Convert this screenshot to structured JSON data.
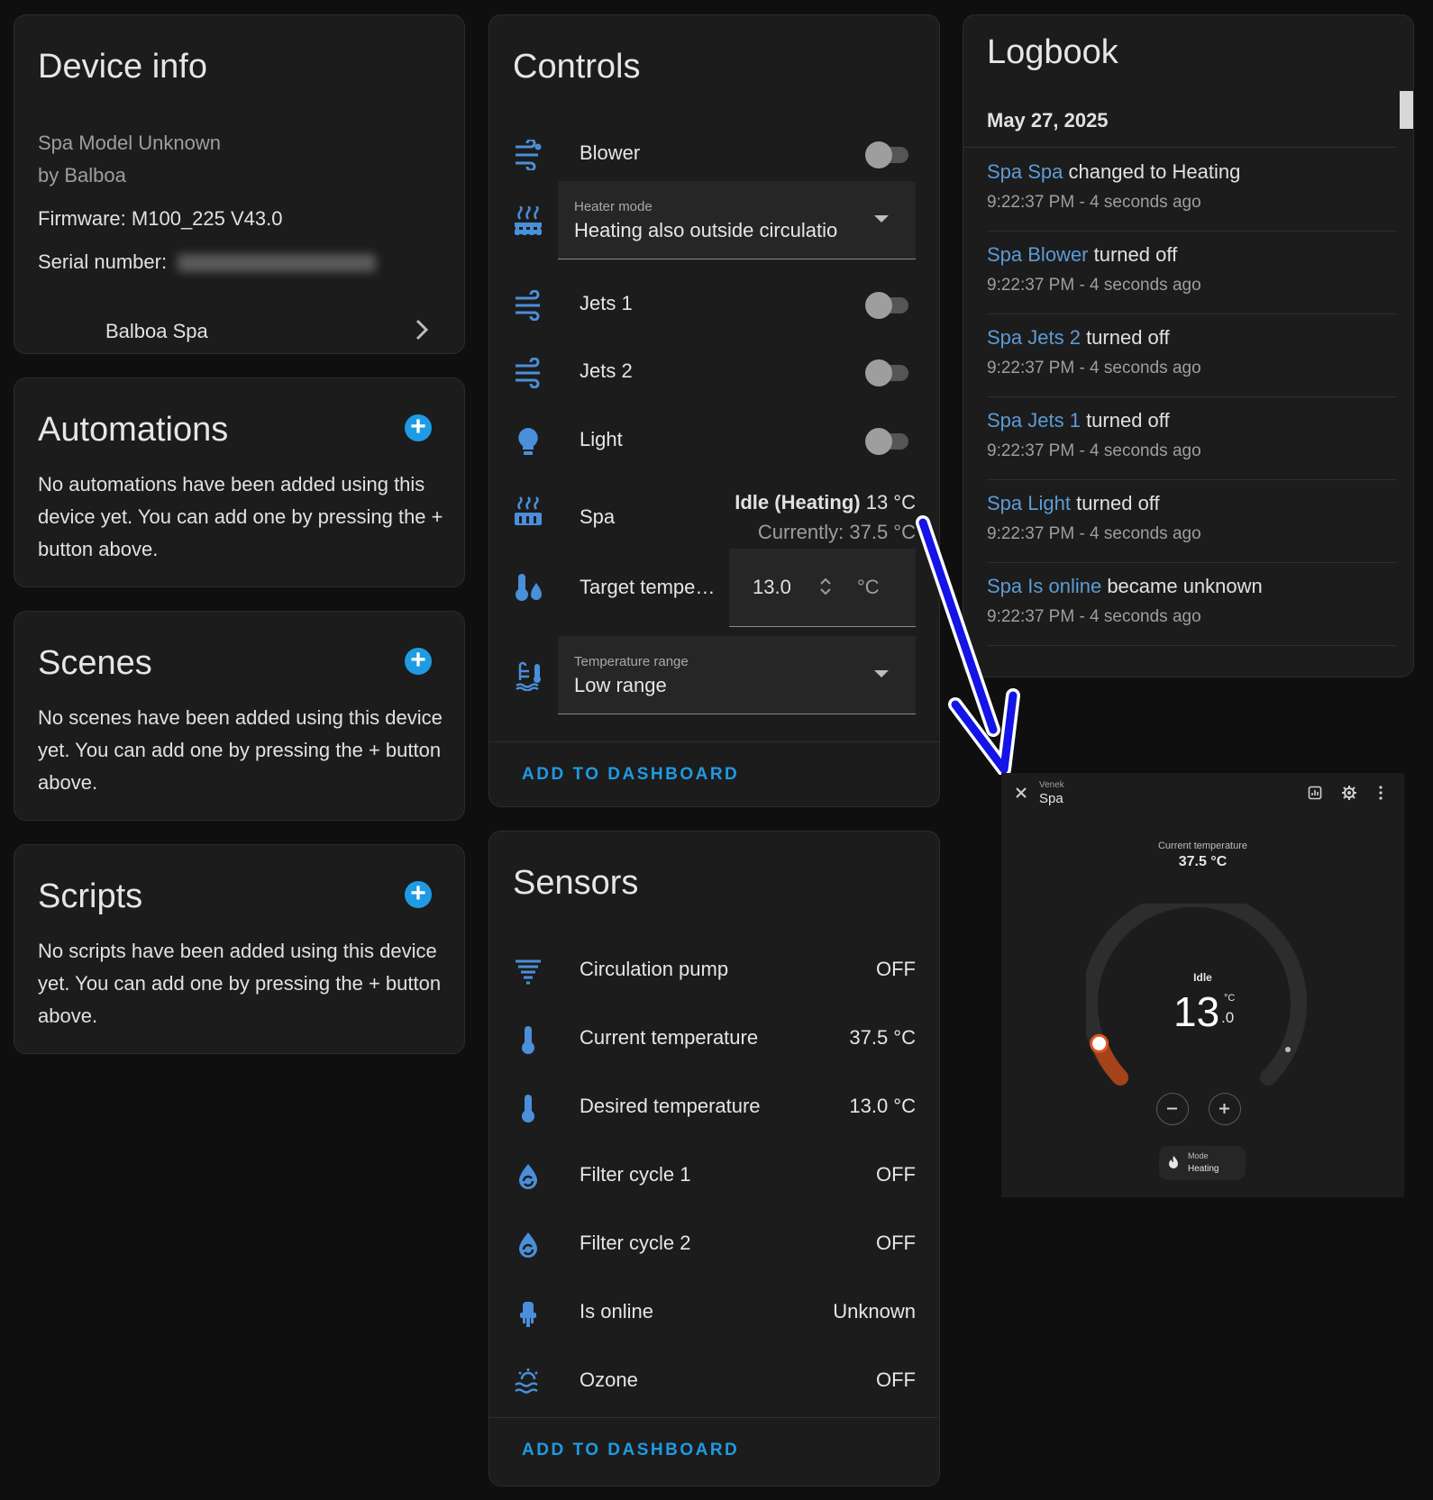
{
  "device_info": {
    "title": "Device info",
    "model": "Spa Model Unknown",
    "manufacturer": "by Balboa",
    "firmware_label": "Firmware:",
    "firmware": "M100_225 V43.0",
    "serial_label": "Serial number:",
    "link_label": "Balboa Spa"
  },
  "automations": {
    "title": "Automations",
    "text": "No automations have been added using this device yet. You can add one by pressing the + button above."
  },
  "scenes": {
    "title": "Scenes",
    "text": "No scenes have been added using this device yet. You can add one by pressing the + button above."
  },
  "scripts": {
    "title": "Scripts",
    "text": "No scripts have been added using this device yet. You can add one by pressing the + button above."
  },
  "controls": {
    "title": "Controls",
    "blower": "Blower",
    "heater_mode_label": "Heater mode",
    "heater_mode_value": "Heating also outside circulatio",
    "jets1": "Jets 1",
    "jets2": "Jets 2",
    "light": "Light",
    "spa": "Spa",
    "spa_state_bold": "Idle (Heating)",
    "spa_state_temp": "13 °C",
    "spa_current": "Currently: 37.5 °C",
    "target_label": "Target tempe…",
    "target_value": "13.0",
    "target_unit": "°C",
    "range_label": "Temperature range",
    "range_value": "Low range",
    "footer": "ADD TO DASHBOARD"
  },
  "sensors": {
    "title": "Sensors",
    "items": [
      {
        "label": "Circulation pump",
        "value": "OFF",
        "icon": "pump-icon"
      },
      {
        "label": "Current temperature",
        "value": "37.5 °C",
        "icon": "thermometer-icon"
      },
      {
        "label": "Desired temperature",
        "value": "13.0 °C",
        "icon": "thermometer-icon"
      },
      {
        "label": "Filter cycle 1",
        "value": "OFF",
        "icon": "water-sync-icon"
      },
      {
        "label": "Filter cycle 2",
        "value": "OFF",
        "icon": "water-sync-icon"
      },
      {
        "label": "Is online",
        "value": "Unknown",
        "icon": "connection-icon"
      },
      {
        "label": "Ozone",
        "value": "OFF",
        "icon": "ozone-icon"
      }
    ],
    "footer": "ADD TO DASHBOARD"
  },
  "logbook": {
    "title": "Logbook",
    "date": "May 27, 2025",
    "entries": [
      {
        "entity": "Spa Spa",
        "action": " changed to Heating",
        "time": "9:22:37 PM - 4 seconds ago"
      },
      {
        "entity": "Spa Blower",
        "action": " turned off",
        "time": "9:22:37 PM - 4 seconds ago"
      },
      {
        "entity": "Spa Jets 2",
        "action": " turned off",
        "time": "9:22:37 PM - 4 seconds ago"
      },
      {
        "entity": "Spa Jets 1",
        "action": " turned off",
        "time": "9:22:37 PM - 4 seconds ago"
      },
      {
        "entity": "Spa Light",
        "action": " turned off",
        "time": "9:22:37 PM - 4 seconds ago"
      },
      {
        "entity": "Spa Is online",
        "action": " became unknown",
        "time": "9:22:37 PM - 4 seconds ago"
      }
    ]
  },
  "dialog": {
    "area": "Venek",
    "name": "Spa",
    "current_label": "Current temperature",
    "current_value": "37.5 °C",
    "state": "Idle",
    "target_int": "13",
    "target_dec": ".0",
    "unit": "°C",
    "mode_label": "Mode",
    "mode_value": "Heating"
  },
  "colors": {
    "accent": "#1e9be3",
    "icon_blue": "#4a8fd9",
    "arrow": "#1414e6",
    "heat": "#b54a1a"
  }
}
